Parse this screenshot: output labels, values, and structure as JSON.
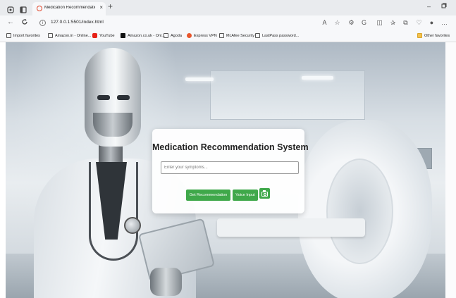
{
  "browser": {
    "tab": {
      "title": "Medication Recommendation Sy"
    },
    "address": {
      "url": "127.0.0.1:5501/index.html"
    },
    "favorites": [
      {
        "label": "Import favorites",
        "icon": "import-icon"
      },
      {
        "label": "Amazon.in - Online...",
        "icon": "page-icon"
      },
      {
        "label": "YouTube",
        "icon": "youtube-icon"
      },
      {
        "label": "Amazon.co.uk - Onl...",
        "icon": "amazon-icon"
      },
      {
        "label": "Agoda",
        "icon": "page-icon"
      },
      {
        "label": "Express VPN",
        "icon": "vpn-icon"
      },
      {
        "label": "McAfee Security",
        "icon": "page-icon"
      },
      {
        "label": "LastPass password...",
        "icon": "page-icon"
      }
    ],
    "other_favorites": "Other favorites"
  },
  "app": {
    "title": "Medication Recommendation System",
    "symptom_placeholder": "Enter your symptoms...",
    "recommend_label": "Get Recommendation",
    "voice_label": "Voice Input",
    "camera_icon": "camera-icon",
    "accent_color": "#3fa84a"
  }
}
